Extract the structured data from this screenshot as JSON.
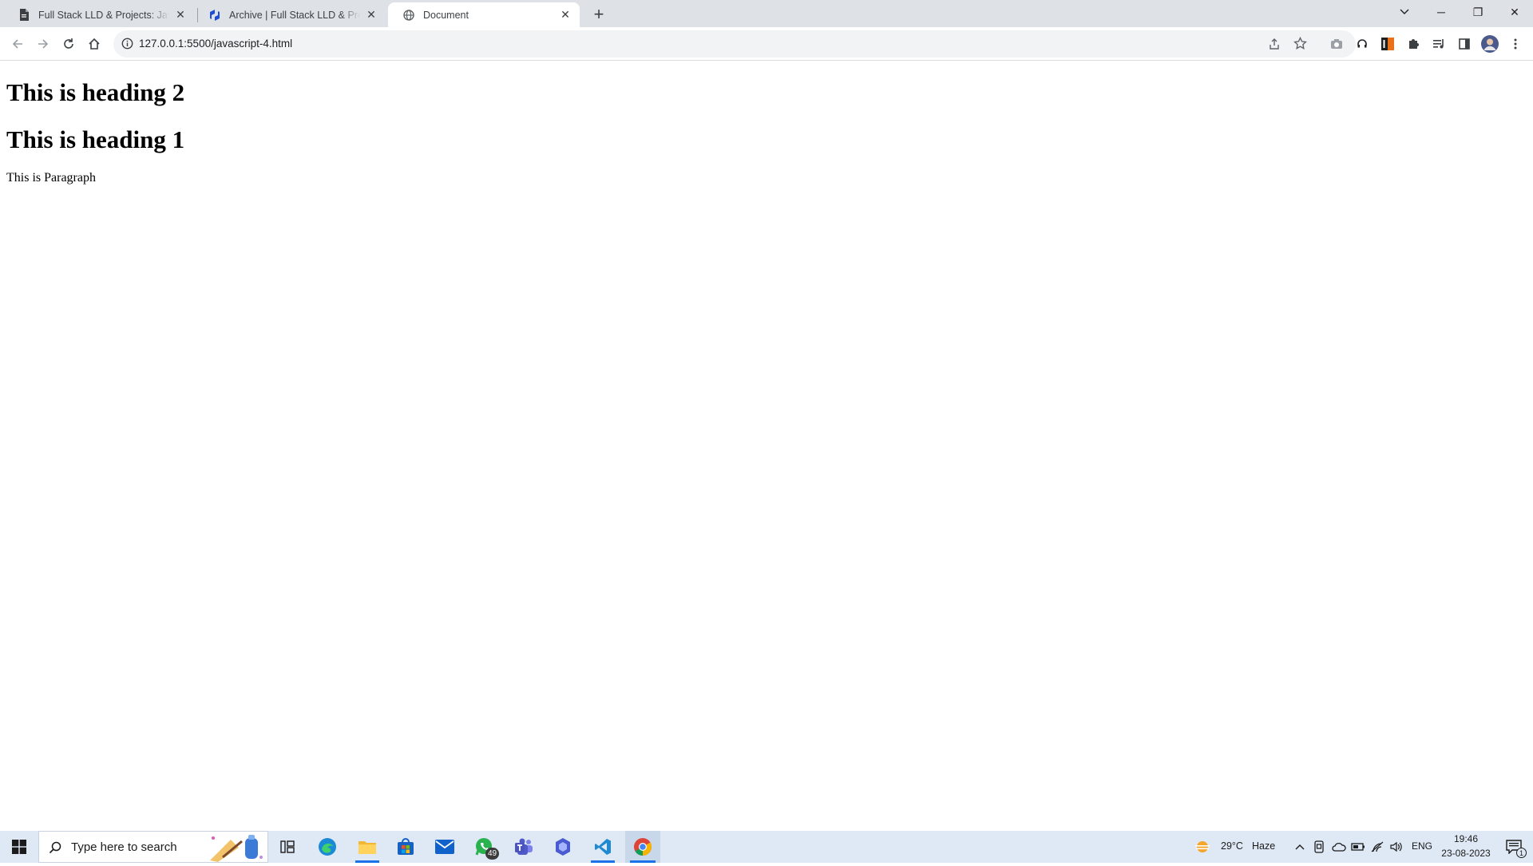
{
  "browser": {
    "tabs": [
      {
        "title": "Full Stack LLD & Projects: JavaScript",
        "icon": "document-icon",
        "active": false
      },
      {
        "title": "Archive | Full Stack LLD & Projects",
        "icon": "scaler-icon",
        "active": false
      },
      {
        "title": "Document",
        "icon": "globe-icon",
        "active": true
      }
    ],
    "new_tab_label": "+",
    "url": "127.0.0.1:5500/javascript-4.html",
    "window_controls": {
      "minimize": "─",
      "restore": "❐",
      "close": "✕"
    }
  },
  "page": {
    "heading_2": "This is heading 2",
    "heading_1": "This is heading 1",
    "paragraph": "This is Paragraph"
  },
  "taskbar": {
    "search_placeholder": "Type here to search",
    "whatsapp_badge": "49",
    "weather": {
      "temp": "29°C",
      "condition": "Haze"
    },
    "language": "ENG",
    "time": "19:46",
    "date": "23-08-2023",
    "notification_count": "1"
  },
  "colors": {
    "tabstrip_bg": "#dee1e6",
    "taskbar_bg": "#dfe9f5",
    "accent": "#1a73e8"
  }
}
